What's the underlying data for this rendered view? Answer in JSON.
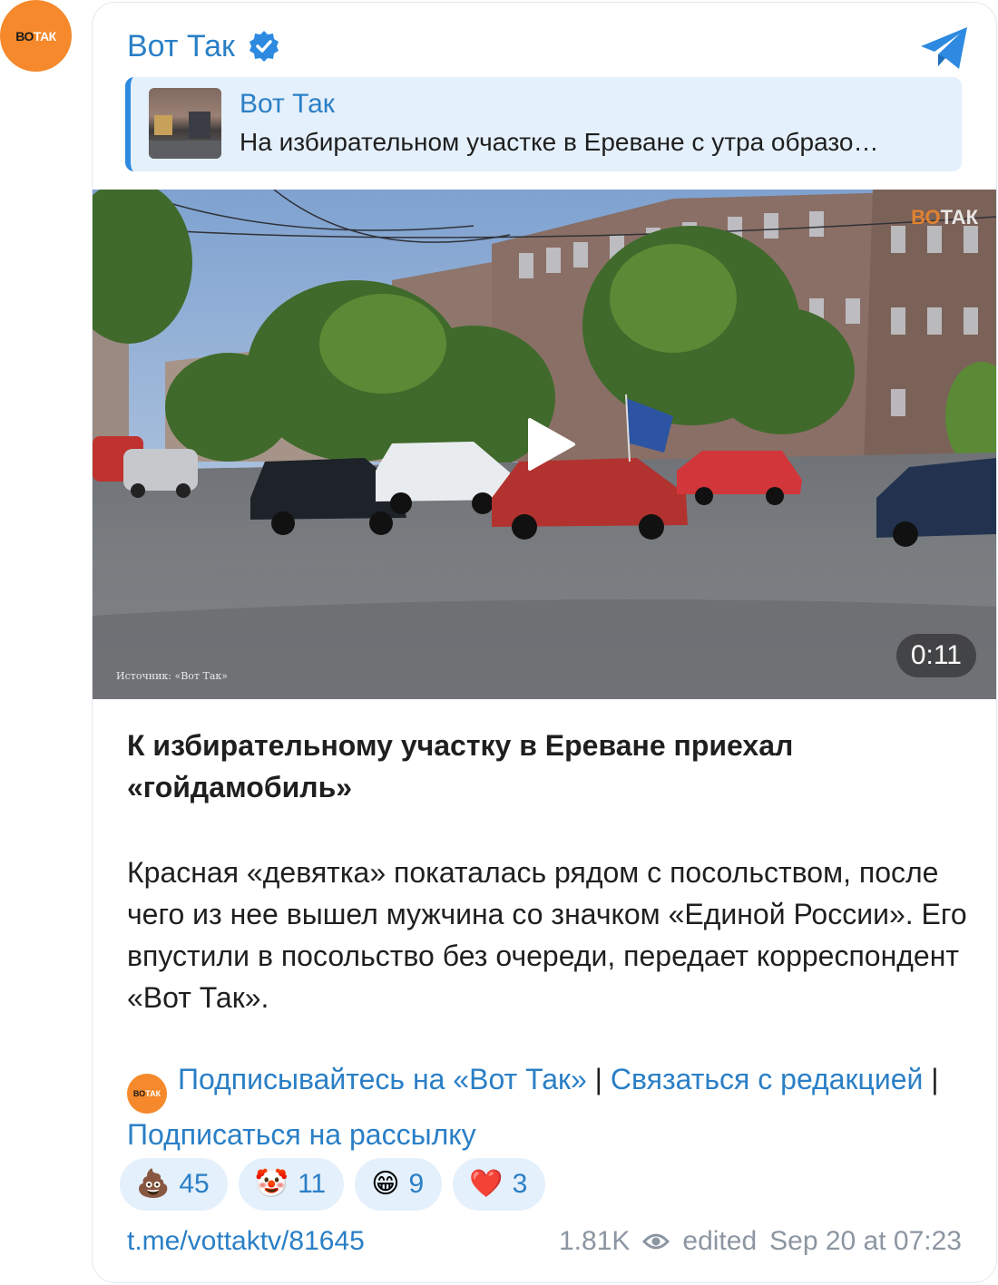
{
  "avatar": {
    "logo_dark": "ВО",
    "logo_light": "ТАК"
  },
  "channel": {
    "name": "Вот Так",
    "verified_icon": "verified-badge-icon",
    "app_icon": "telegram-icon"
  },
  "quote": {
    "title": "Вот Так",
    "text": "На избирательном участке в Ереване с утра образо…"
  },
  "video": {
    "duration": "0:11",
    "watermark_source": "Источник: «Вот Так»",
    "watermark_logo_dark": "ВО",
    "watermark_logo_light": "ТАК"
  },
  "post": {
    "title": "К избирательному участку в Ереване приехал «гойдамобиль»",
    "body": "Красная «девятка» покаталась рядом с посольством, после чего из нее вышел мужчина со значком «Единой России». Его впустили в посольство без очереди, передает корреспондент «Вот Так»."
  },
  "links": {
    "mini_logo_dark": "ВО",
    "mini_logo_light": "ТАК",
    "subscribe": "Подписывайтесь на «Вот Так»",
    "separator": " | ",
    "contact": "Связаться с редакцией",
    "newsletter": "Подписаться на рассылку"
  },
  "reactions": [
    {
      "emoji": "💩",
      "count": "45"
    },
    {
      "emoji": "🤡",
      "count": "11"
    },
    {
      "emoji": "😁",
      "count": "9"
    },
    {
      "emoji": "❤️",
      "count": "3"
    }
  ],
  "footer": {
    "link": "t.me/vottaktv/81645",
    "views": "1.81K",
    "edited": "edited",
    "date": "Sep 20 at 07:23"
  },
  "colors": {
    "accent": "#2a7fc6",
    "brand_orange": "#f5892b",
    "quote_bg": "#e4f0fb"
  }
}
